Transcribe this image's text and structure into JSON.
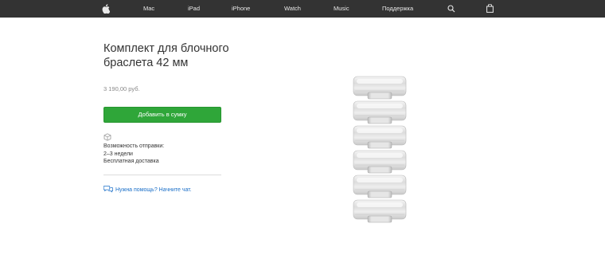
{
  "nav": {
    "logo_icon": "apple-logo-icon",
    "items": [
      {
        "label": "Mac"
      },
      {
        "label": "iPad"
      },
      {
        "label": "iPhone"
      },
      {
        "label": "Watch"
      },
      {
        "label": "Music"
      },
      {
        "label": "Поддержка"
      }
    ],
    "search_icon": "search-icon",
    "bag_icon": "shopping-bag-icon",
    "background": "#333333"
  },
  "product": {
    "title": "Комплект для блочного браслета 42 мм",
    "price": "3 190,00 руб.",
    "add_to_bag_label": "Добавить в сумку",
    "button_color": "#2fa639"
  },
  "shipping": {
    "icon": "box-icon",
    "lines": [
      "Возможность отправки:",
      "2–3 недели",
      "Бесплатная доставка"
    ]
  },
  "help": {
    "icon": "chat-bubbles-icon",
    "link_text": "Нужна помощь? Начните чат.",
    "link_color": "#1a6fc8"
  },
  "image": {
    "subject": "stainless-steel-link-bracelet-kit",
    "links_count": 6
  }
}
